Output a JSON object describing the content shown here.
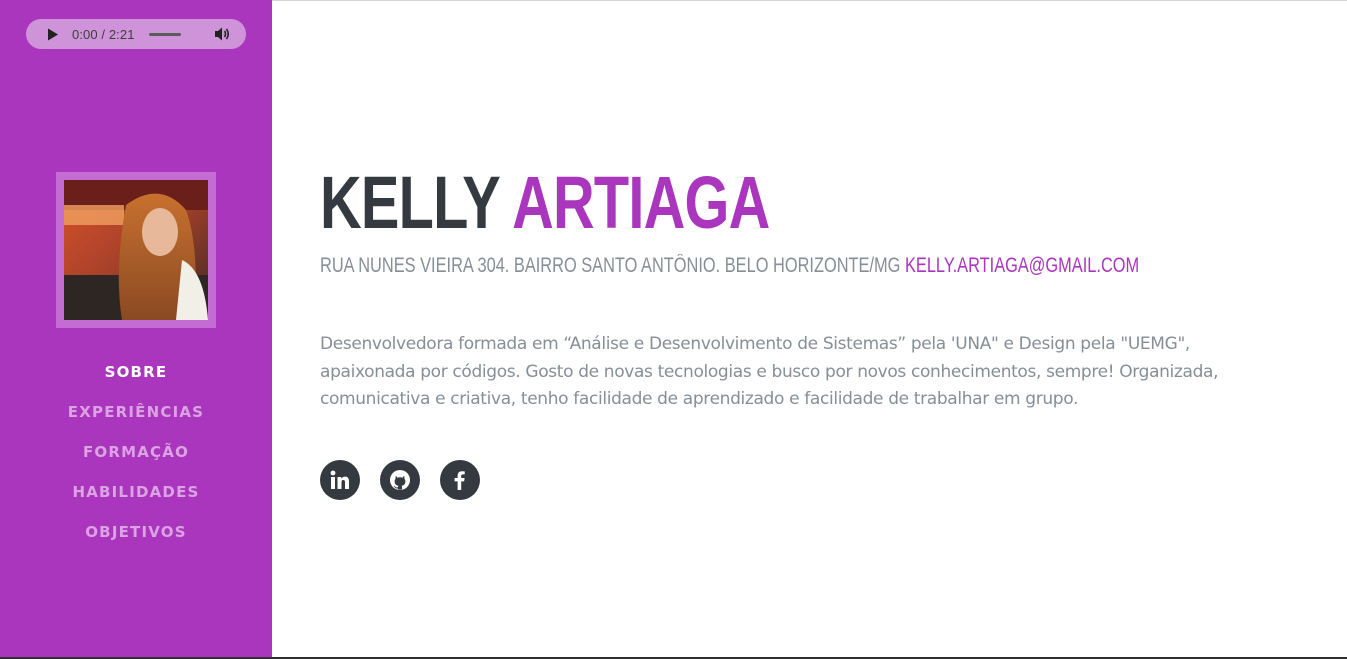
{
  "audio_player": {
    "time": "0:00 / 2:21",
    "play_icon": "play-icon",
    "volume_icon": "volume-icon"
  },
  "avatar": {
    "alt": "Kelly Artiaga"
  },
  "nav": {
    "items": [
      {
        "label": "SOBRE",
        "active": true
      },
      {
        "label": "EXPERIÊNCIAS",
        "active": false
      },
      {
        "label": "FORMAÇÃO",
        "active": false
      },
      {
        "label": "HABILIDADES",
        "active": false
      },
      {
        "label": "OBJETIVOS",
        "active": false
      }
    ]
  },
  "profile": {
    "first_name": "KELLY",
    "last_name": "ARTIAGA",
    "address": "RUA NUNES VIEIRA 304. BAIRRO SANTO ANTÔNIO. BELO HORIZONTE/MG",
    "email": "KELLY.ARTIAGA@GMAIL.COM",
    "bio": "Desenvolvedora formada em “Análise e Desenvolvimento de Sistemas” pela 'UNA\" e Design pela \"UEMG\", apaixonada por códigos. Gosto de novas tecnologias e busco por novos conhecimentos, sempre! Organizada, comunicativa e criativa, tenho facilidade de aprendizado e facilidade de trabalhar em grupo."
  },
  "social": [
    {
      "name": "linkedin-icon"
    },
    {
      "name": "github-icon"
    },
    {
      "name": "facebook-icon"
    }
  ],
  "colors": {
    "primary": "#a936bd",
    "dark": "#343a40",
    "muted": "#868e96",
    "nav_inactive": "#dba3e4"
  }
}
